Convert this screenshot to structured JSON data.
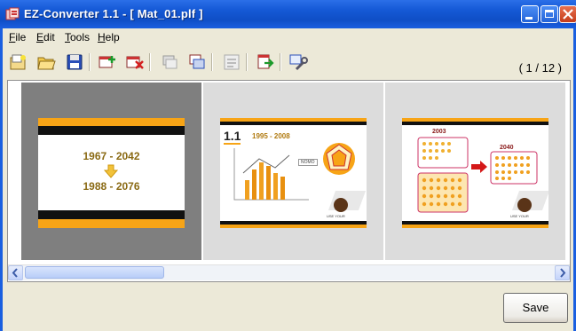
{
  "window": {
    "title": "EZ-Converter 1.1  - [ Mat_01.plf ]"
  },
  "menu": {
    "items": [
      {
        "label": "File"
      },
      {
        "label": "Edit"
      },
      {
        "label": "Tools"
      },
      {
        "label": "Help"
      }
    ]
  },
  "toolbar": {
    "icons": [
      "new-project-icon",
      "open-folder-icon",
      "save-disk-icon",
      "add-slide-icon",
      "delete-slide-icon",
      "move-back-icon",
      "move-forward-icon",
      "properties-icon",
      "export-icon",
      "settings-wrench-icon"
    ],
    "page_counter": "( 1 / 12 )"
  },
  "slides": [
    {
      "line1": "1967 - 2042",
      "line2": "1988 - 2076"
    },
    {
      "section": "1.1",
      "range": "1995 - 2008",
      "chart_label": "NOMO",
      "footer": "USE YOUR"
    },
    {
      "year_left": "2003",
      "year_right": "2040",
      "footer": "USE YOUR"
    }
  ],
  "actions": {
    "save_label": "Save"
  },
  "colors": {
    "title_bar": "#1559d6",
    "slide_accent": "#f7a416",
    "slide_band": "#111111",
    "selected_thumb": "#7f7f7f"
  }
}
